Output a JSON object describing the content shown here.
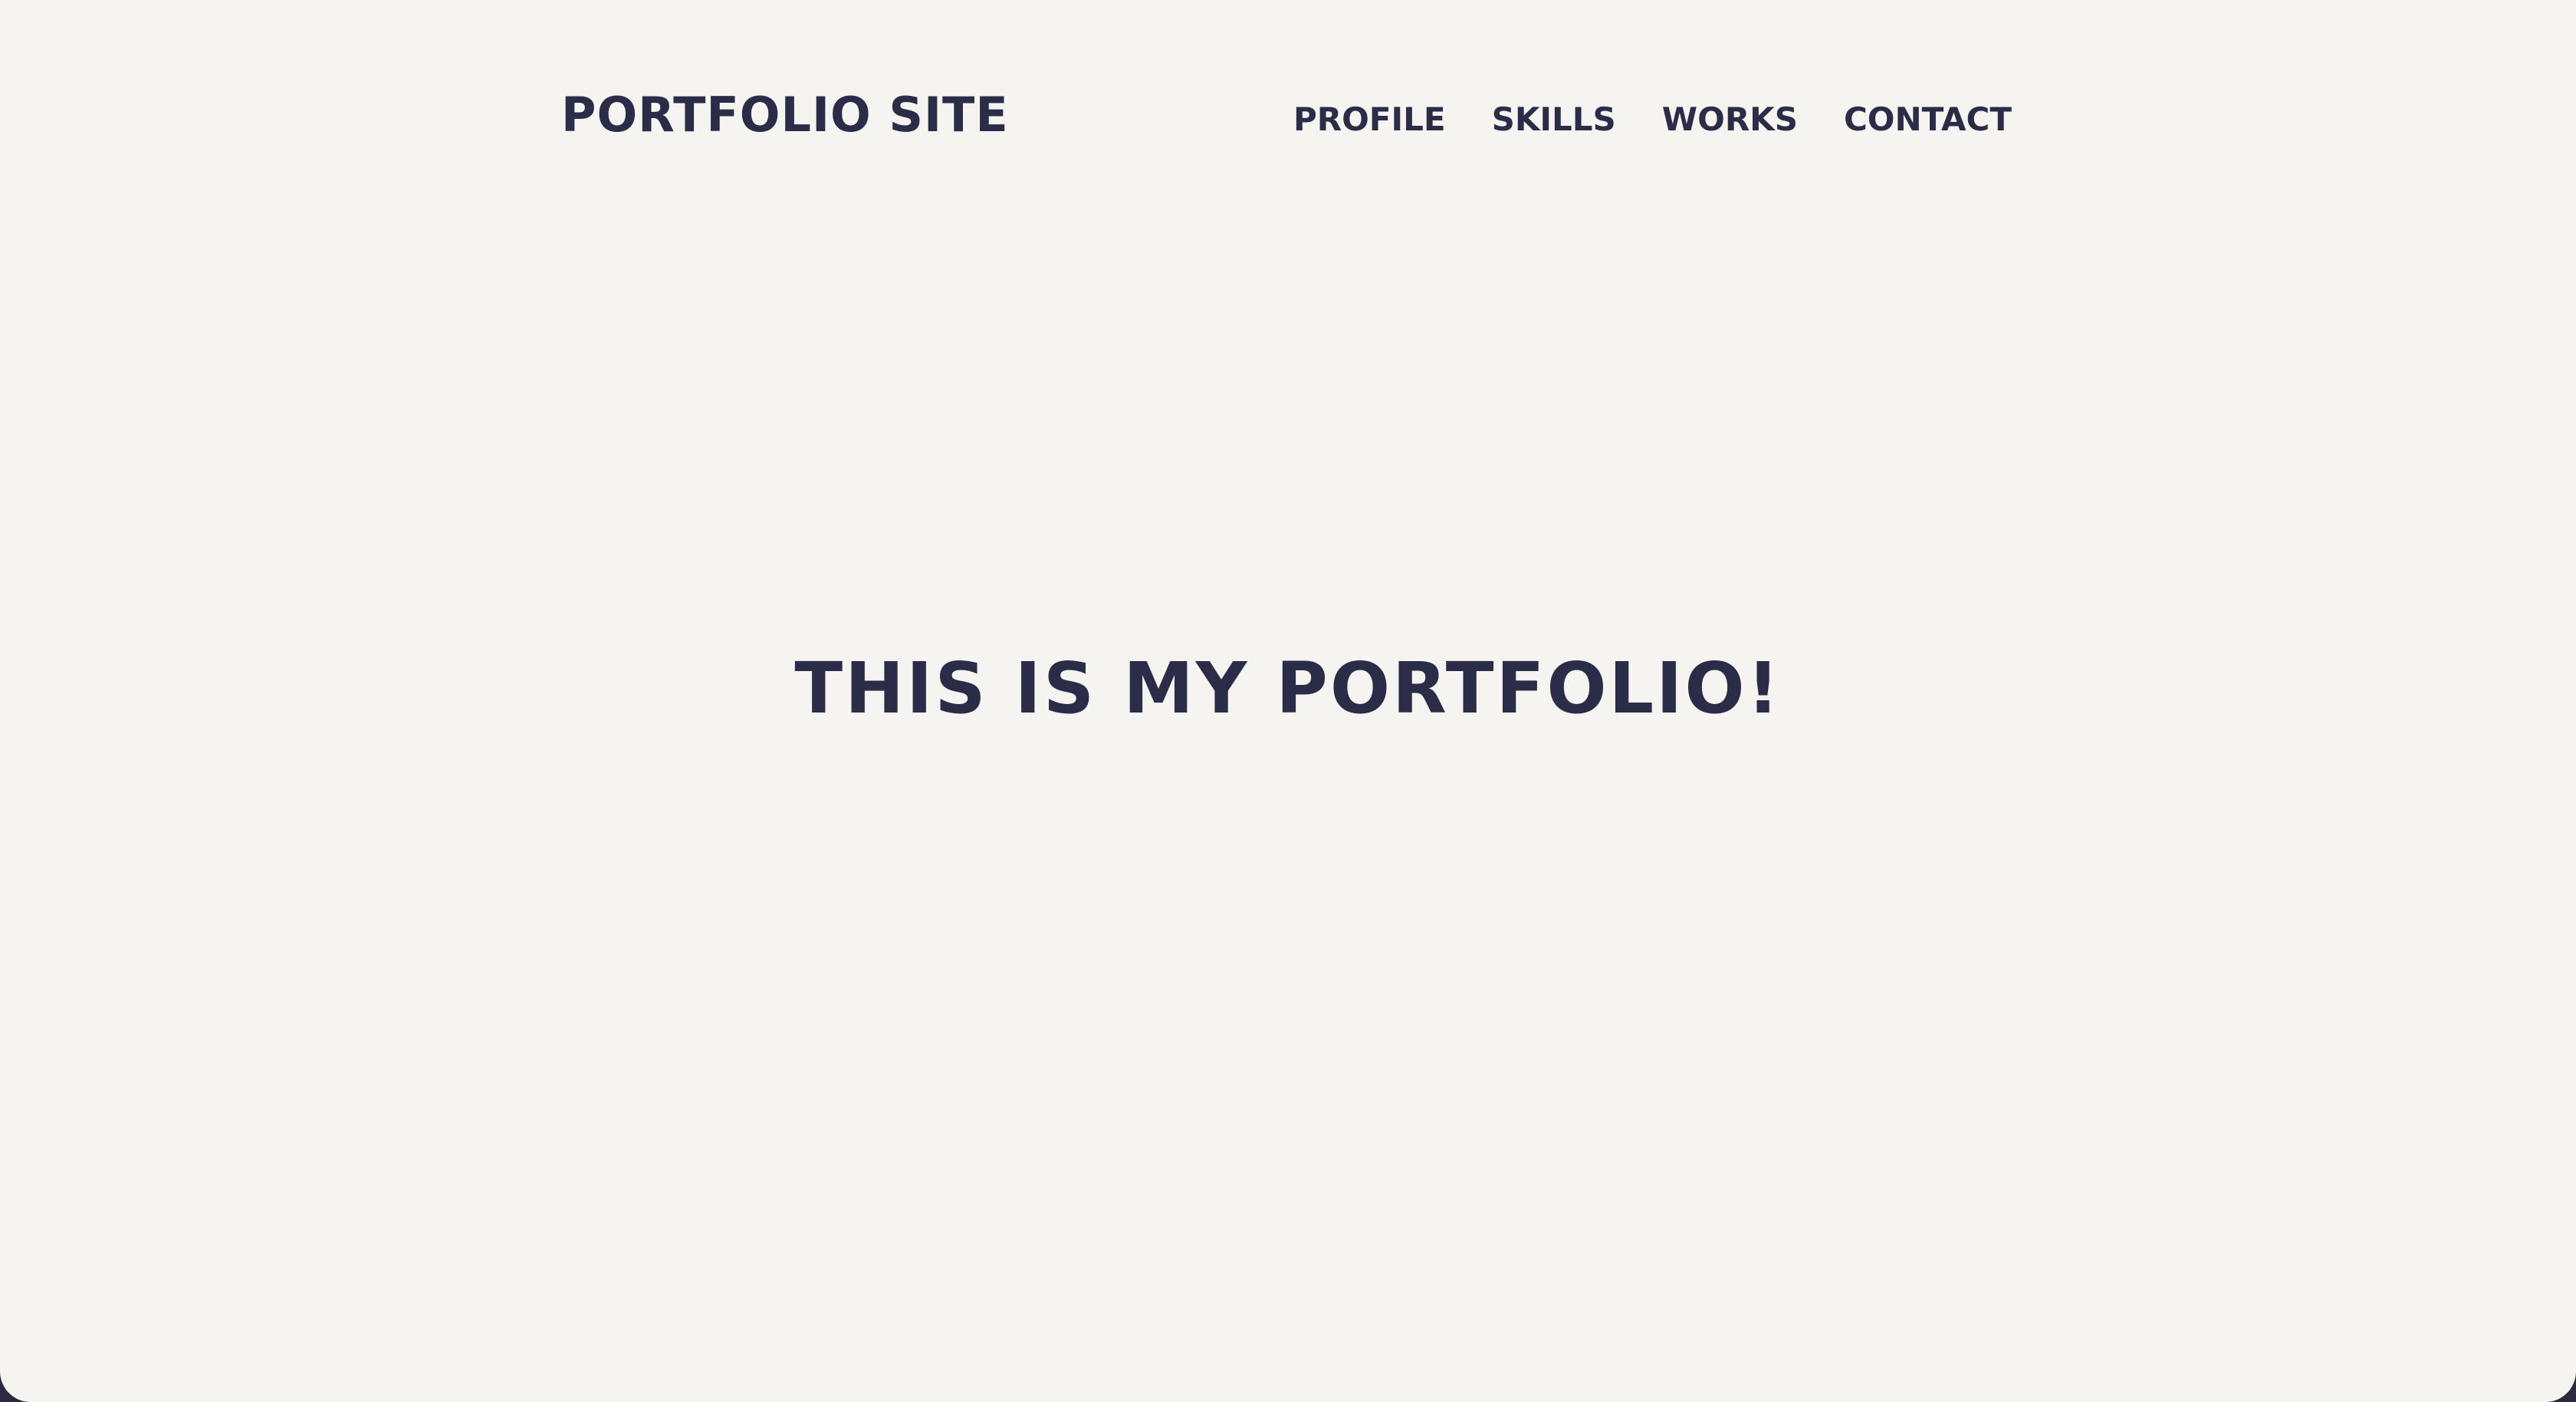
{
  "header": {
    "brand": "PORTFOLIO SITE",
    "nav": [
      {
        "label": "PROFILE"
      },
      {
        "label": "SKILLS"
      },
      {
        "label": "WORKS"
      },
      {
        "label": "CONTACT"
      }
    ]
  },
  "hero": {
    "headline": "THIS IS MY PORTFOLIO!"
  },
  "colors": {
    "background": "#f6f4f0",
    "text": "#2b2d48",
    "frame": "#2a2b3f"
  }
}
